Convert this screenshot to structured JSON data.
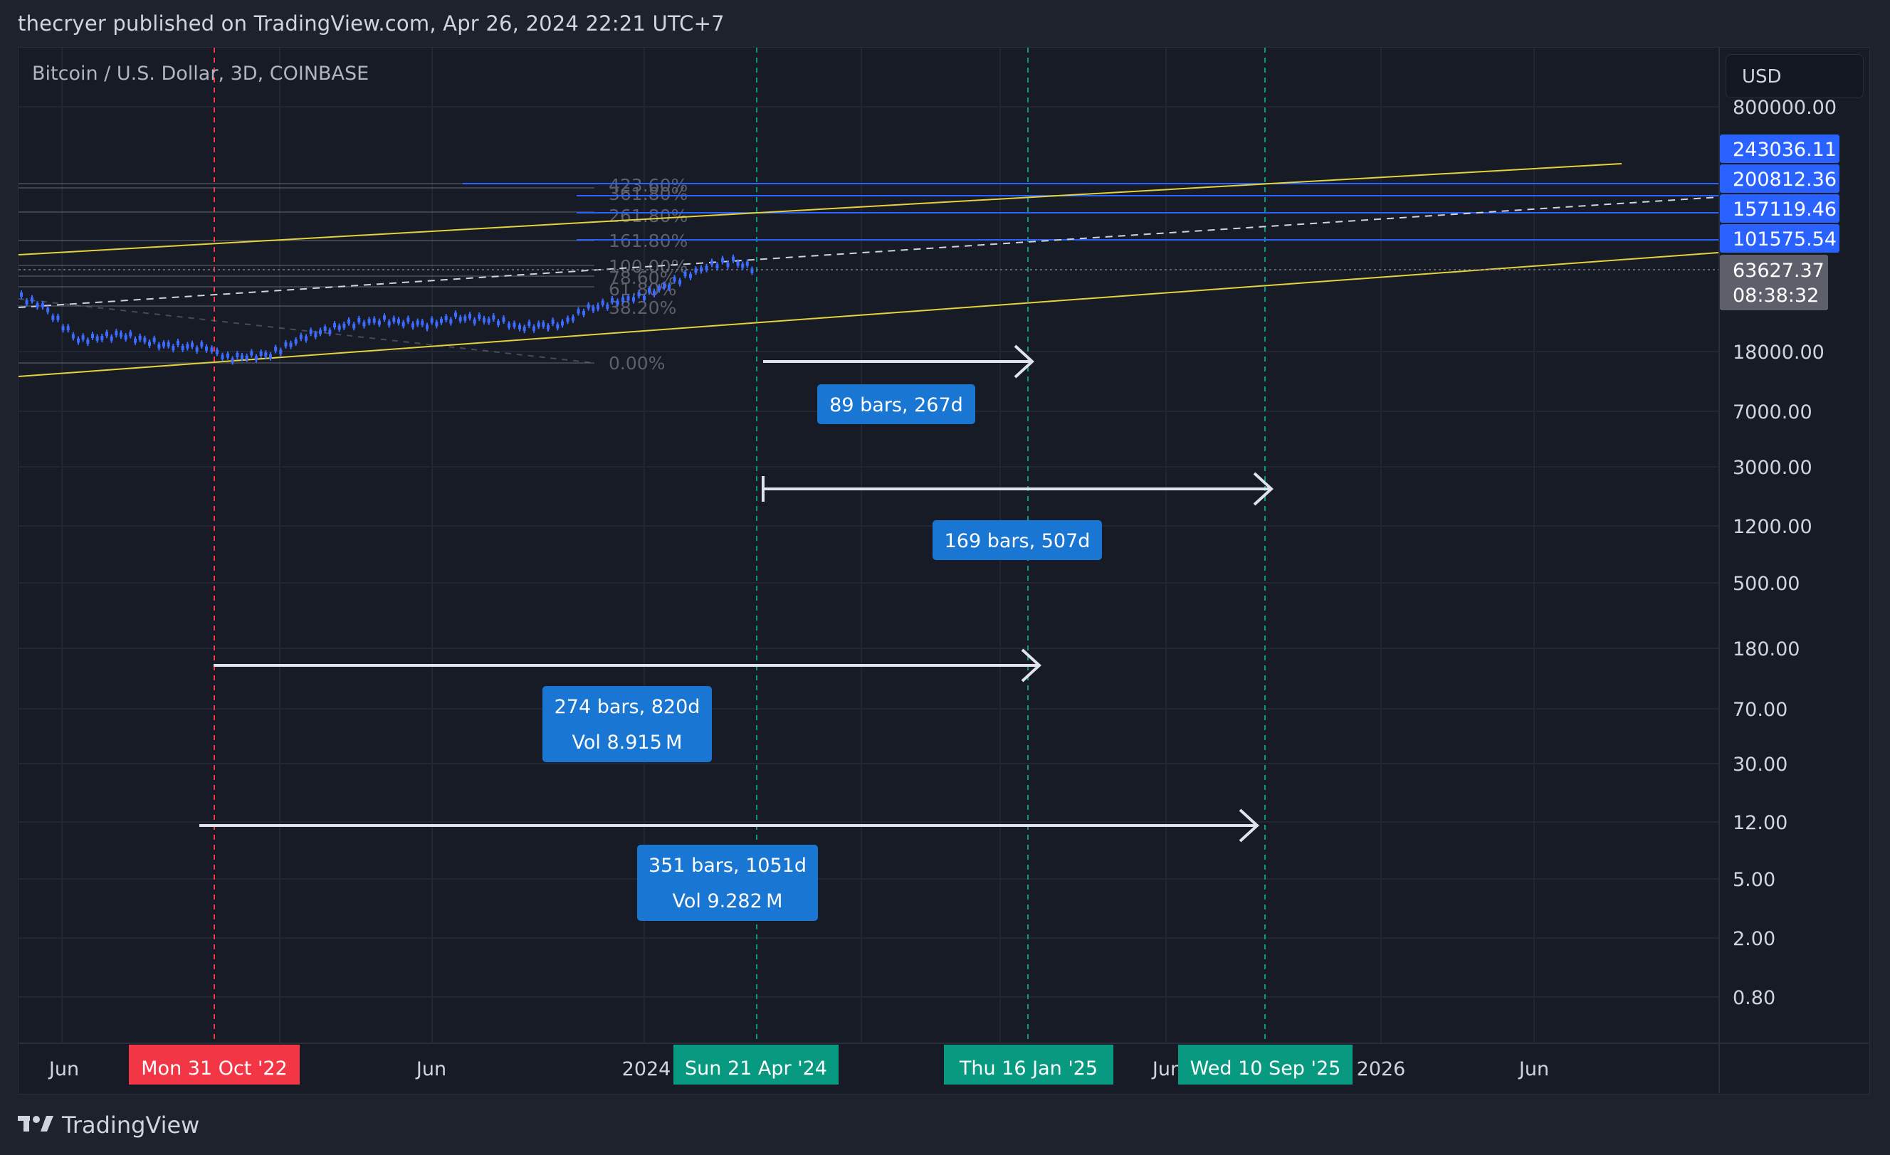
{
  "header": {
    "text": "thecryer published on TradingView.com, Apr 26, 2024 22:21 UTC+7"
  },
  "symbol": {
    "title": "Bitcoin / U.S. Dollar, 3D, COINBASE"
  },
  "currency": {
    "label": "USD"
  },
  "footer": {
    "brand": "TradingView"
  },
  "colors": {
    "background": "#171b26",
    "grid": "#222632",
    "channel": "#e5d33b",
    "fib_line": "#2962ff",
    "price_label": "#2962ff",
    "current_price_label": "#5d606b",
    "arrow": "#e0e3eb",
    "measure_box": "#1976d2",
    "red_marker": "#f23645",
    "green_marker": "#089981",
    "candle": "#3d6bff"
  },
  "chart_data": {
    "type": "candlestick",
    "title": "Bitcoin / U.S. Dollar, 3D, COINBASE",
    "y_scale": "log",
    "x_axis_ticks": [
      "Jun",
      "Jun",
      "2024",
      "Jun",
      "2026",
      "Jun"
    ],
    "y_axis_ticks": [
      "800000.00",
      "18000.00",
      "7000.00",
      "3000.00",
      "1200.00",
      "500.00",
      "180.00",
      "70.00",
      "30.00",
      "12.00",
      "5.00",
      "2.00",
      "0.80"
    ],
    "price_labels": [
      "243036.11",
      "200812.36",
      "157119.46",
      "101575.54"
    ],
    "current_price": "63627.37",
    "countdown": "08:38:32",
    "fib_levels": [
      "423.60%",
      "361.80%",
      "261.80%",
      "161.80%",
      "100.00%",
      "78.60%",
      "61.80%",
      "38.20%",
      "0.00%"
    ],
    "date_markers": [
      {
        "label": "Mon 31 Oct '22",
        "kind": "red"
      },
      {
        "label": "Sun 21 Apr '24",
        "kind": "green"
      },
      {
        "label": "Thu 16 Jan '25",
        "kind": "green"
      },
      {
        "label": "Wed 10 Sep '25",
        "kind": "green"
      }
    ],
    "measurements": [
      {
        "lines": [
          "89 bars, 267d"
        ]
      },
      {
        "lines": [
          "169 bars, 507d"
        ]
      },
      {
        "lines": [
          "274 bars, 820d",
          "Vol 8.915 M"
        ]
      },
      {
        "lines": [
          "351 bars, 1051d",
          "Vol 9.282 M"
        ]
      }
    ]
  }
}
